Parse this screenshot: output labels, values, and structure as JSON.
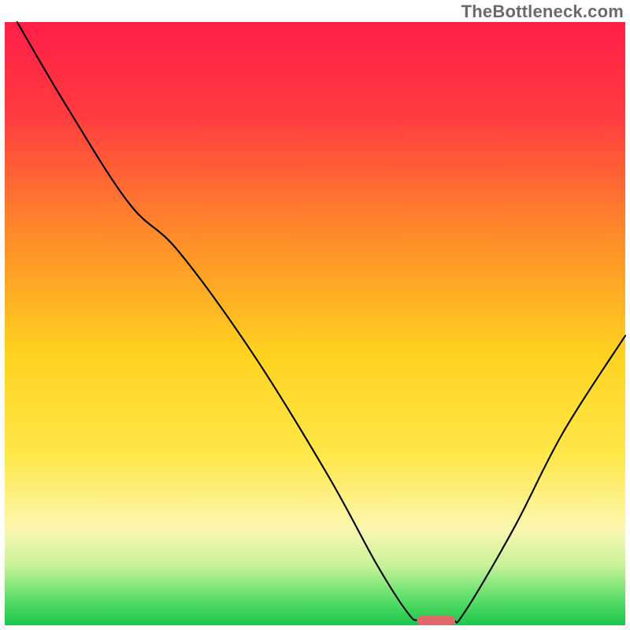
{
  "watermark": "TheBottleneck.com",
  "chart_data": {
    "type": "line",
    "title": "",
    "xlabel": "",
    "ylabel": "",
    "xlim": [
      0,
      100
    ],
    "ylim": [
      0,
      100
    ],
    "background_gradient": {
      "stops": [
        {
          "offset": 0,
          "color": "#ff1f47"
        },
        {
          "offset": 15,
          "color": "#ff3a3f"
        },
        {
          "offset": 35,
          "color": "#ff8a2a"
        },
        {
          "offset": 55,
          "color": "#ffd21f"
        },
        {
          "offset": 72,
          "color": "#ffe84a"
        },
        {
          "offset": 84,
          "color": "#fbf7b0"
        },
        {
          "offset": 90,
          "color": "#c9f29a"
        },
        {
          "offset": 95,
          "color": "#66e26e"
        },
        {
          "offset": 100,
          "color": "#19c64a"
        }
      ]
    },
    "series": [
      {
        "name": "bottleneck-curve",
        "color": "#000000",
        "width": 2.1,
        "points": [
          {
            "x": 2,
            "y": 100
          },
          {
            "x": 10,
            "y": 86
          },
          {
            "x": 20,
            "y": 70
          },
          {
            "x": 28,
            "y": 62
          },
          {
            "x": 40,
            "y": 45
          },
          {
            "x": 52,
            "y": 25
          },
          {
            "x": 60,
            "y": 10
          },
          {
            "x": 65,
            "y": 2
          },
          {
            "x": 67,
            "y": 0.8
          },
          {
            "x": 72,
            "y": 0.8
          },
          {
            "x": 74,
            "y": 2
          },
          {
            "x": 82,
            "y": 16
          },
          {
            "x": 90,
            "y": 32
          },
          {
            "x": 100,
            "y": 48
          }
        ]
      }
    ],
    "marker": {
      "name": "optimal-pill",
      "cx": 69.5,
      "cy": 0.8,
      "width": 6.2,
      "height": 1.6,
      "rx": 1.0,
      "color": "#e06a6e"
    }
  }
}
